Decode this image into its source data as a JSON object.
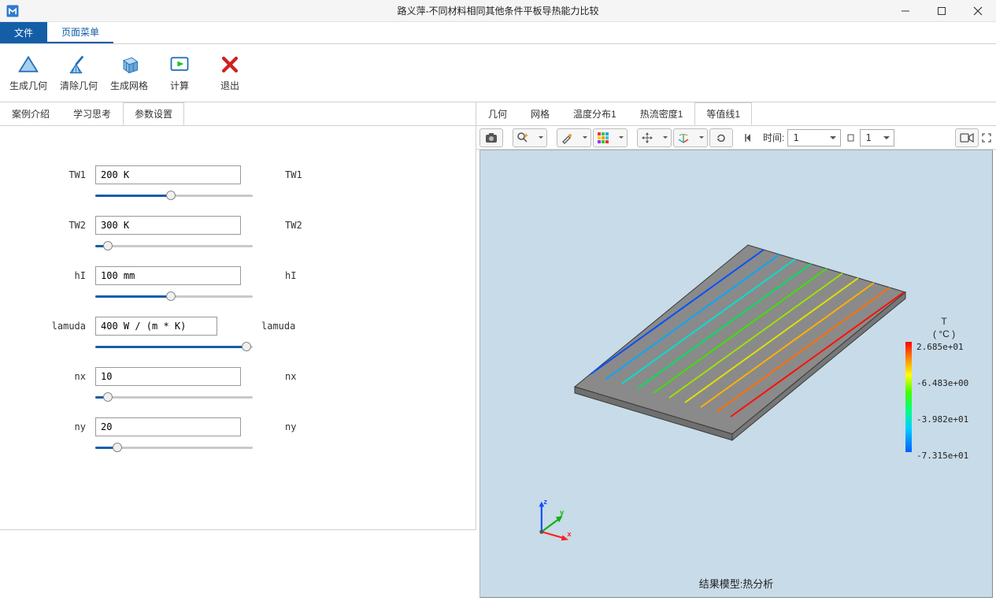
{
  "window": {
    "title": "路义萍-不同材料相同其他条件平板导热能力比较"
  },
  "ribbon_tabs": {
    "file": "文件",
    "page_menu": "页面菜单"
  },
  "ribbon_buttons": {
    "gen_geom": "生成几何",
    "clear_geom": "清除几何",
    "gen_mesh": "生成网格",
    "compute": "计算",
    "exit": "退出"
  },
  "left_tabs": {
    "case_intro": "案例介绍",
    "study_think": "学习思考",
    "param_set": "参数设置"
  },
  "right_tabs": {
    "geometry": "几何",
    "mesh": "网格",
    "temp_dist": "温度分布1",
    "heat_flux": "热流密度1",
    "contour": "等值线1"
  },
  "params": {
    "tw1": {
      "left": "TW1",
      "value": "200 K",
      "right": "TW1",
      "pct": 48
    },
    "tw2": {
      "left": "TW2",
      "value": "300 K",
      "right": "TW2",
      "pct": 8
    },
    "hi": {
      "left": "hI",
      "value": "100 mm",
      "right": "hI",
      "pct": 48
    },
    "lamuda": {
      "left": "lamuda",
      "value": "400 W / (m * K)",
      "right": "lamuda",
      "pct": 96
    },
    "nx": {
      "left": "nx",
      "value": "10",
      "right": "nx",
      "pct": 8
    },
    "ny": {
      "left": "ny",
      "value": "20",
      "right": "ny",
      "pct": 14
    }
  },
  "view_toolbar": {
    "time_label": "时间:",
    "time_value": "1",
    "frame_value": "1",
    "icons": {
      "camera": "camera-icon",
      "magic_zoom": "zoom-spark-icon",
      "brush": "brush-icon",
      "rubik": "rubik-icon",
      "move": "move-arrows-icon",
      "rotate_axes": "rotate-axes-icon",
      "reset": "reset-rotate-icon",
      "frame_play": "play-end-icon",
      "video": "video-icon",
      "fullscreen": "fullscreen-icon"
    }
  },
  "viewer": {
    "result_title": "结果模型:热分析",
    "axes": {
      "x": "x",
      "y": "y",
      "z": "z"
    },
    "colorbar_title1": "T",
    "colorbar_title2": "( °C )",
    "ticks": [
      "2.685e+01",
      "-6.483e+00",
      "-3.982e+01",
      "-7.315e+01"
    ]
  },
  "chart_data": {
    "type": "heatmap",
    "title": "结果模型:热分析",
    "variable": "T",
    "unit": "°C",
    "colorscale_range": [
      -73.15,
      26.85
    ],
    "colorscale_ticks": [
      26.85,
      -6.483,
      -39.82,
      -73.15
    ],
    "geometry": "thin rectangular plate, isometric view",
    "contour_lines_count": 10,
    "axes": [
      "x",
      "y",
      "z"
    ]
  }
}
